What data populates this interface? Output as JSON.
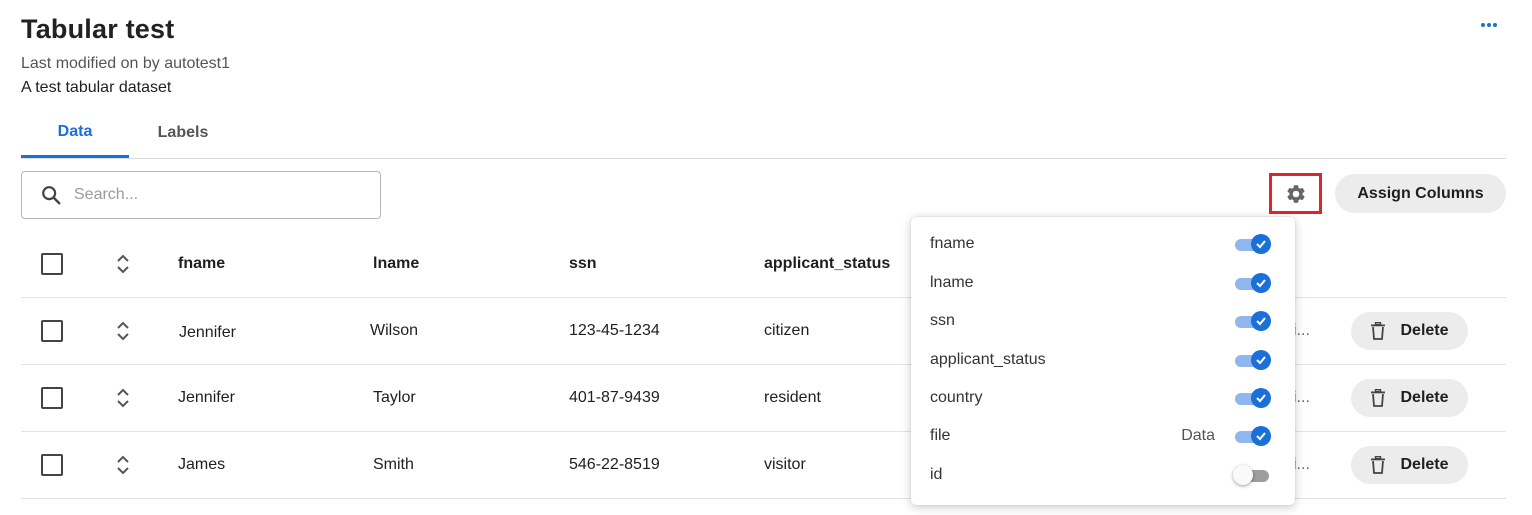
{
  "header": {
    "title": "Tabular test",
    "meta": "Last modified on by autotest1",
    "description": "A test tabular dataset",
    "more_icon": "more-horizontal-icon"
  },
  "tabs": [
    {
      "label": "Data",
      "active": true
    },
    {
      "label": "Labels",
      "active": false
    }
  ],
  "toolbar": {
    "search_placeholder": "Search...",
    "search_icon": "search-icon",
    "settings_icon": "gear-icon",
    "assign_label": "Assign Columns"
  },
  "table": {
    "columns": [
      "fname",
      "lname",
      "ssn",
      "applicant_status"
    ],
    "rows": [
      {
        "fname": "Jennifer",
        "lname": "Wilson",
        "ssn": "123-45-1234",
        "applicant_status": "citizen",
        "truncated": "i..."
      },
      {
        "fname": "Jennifer",
        "lname": "Taylor",
        "ssn": "401-87-9439",
        "applicant_status": "resident",
        "truncated": "i..."
      },
      {
        "fname": "James",
        "lname": "Smith",
        "ssn": "546-22-8519",
        "applicant_status": "visitor",
        "truncated": "i..."
      }
    ],
    "delete_label": "Delete",
    "delete_icon": "trash-icon"
  },
  "column_menu": {
    "items": [
      {
        "label": "fname",
        "tag": "",
        "enabled": true
      },
      {
        "label": "lname",
        "tag": "",
        "enabled": true
      },
      {
        "label": "ssn",
        "tag": "",
        "enabled": true
      },
      {
        "label": "applicant_status",
        "tag": "",
        "enabled": true
      },
      {
        "label": "country",
        "tag": "",
        "enabled": true
      },
      {
        "label": "file",
        "tag": "Data",
        "enabled": true
      },
      {
        "label": "id",
        "tag": "",
        "enabled": false
      }
    ]
  },
  "colors": {
    "accent": "#1a6fd8",
    "highlight_border": "#e0242b"
  }
}
